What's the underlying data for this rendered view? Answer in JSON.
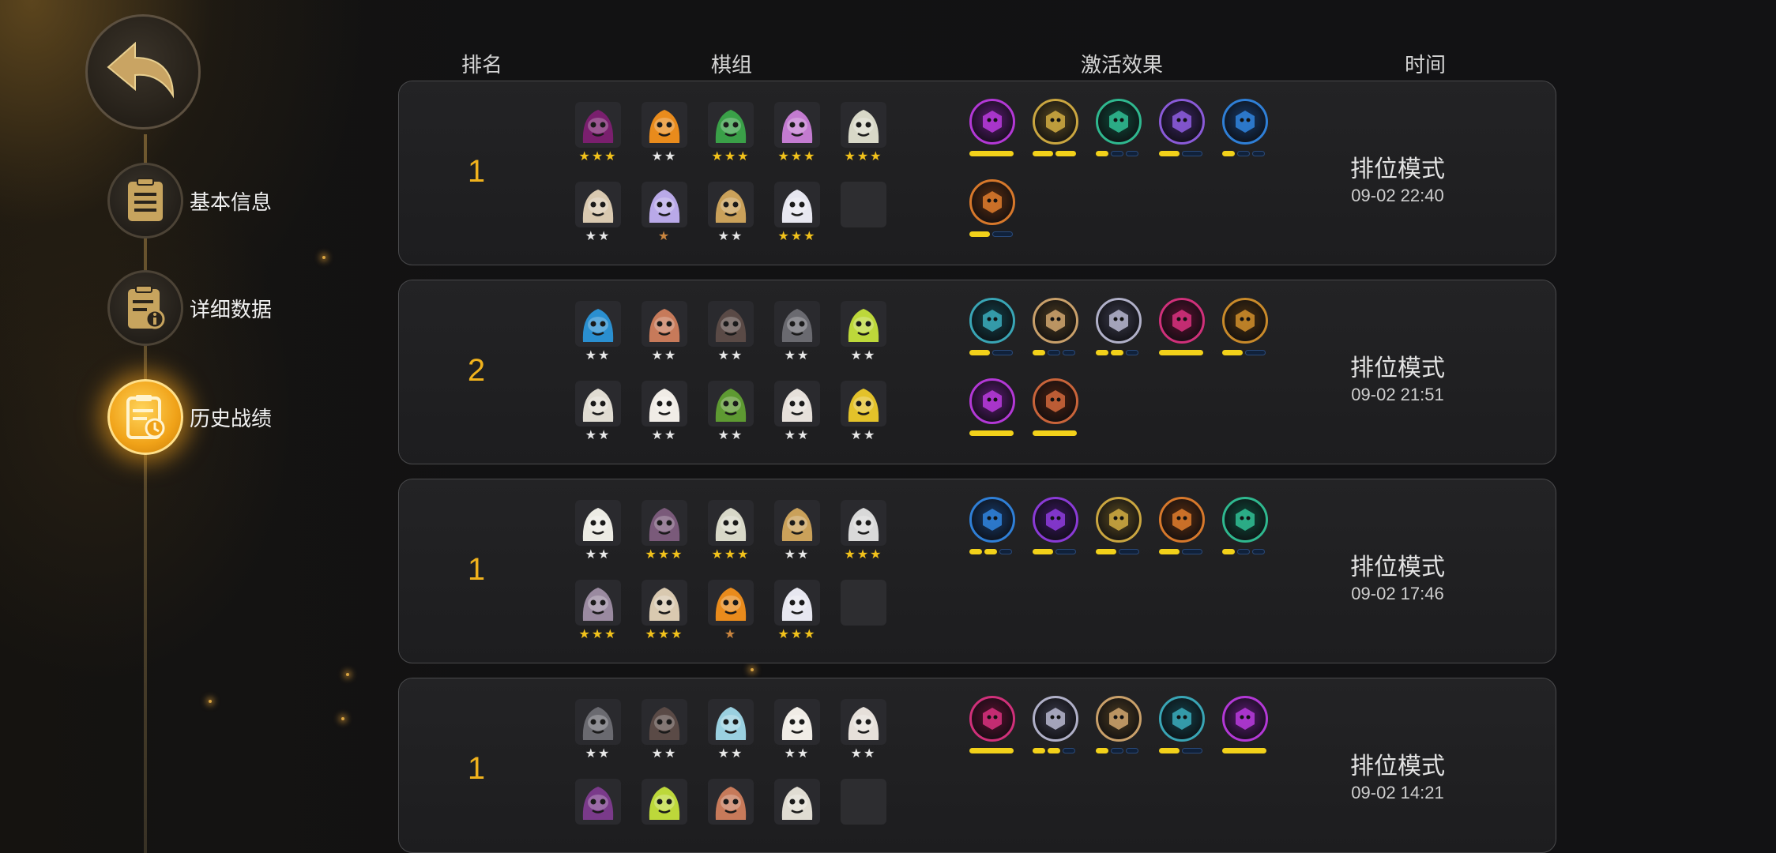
{
  "header": {
    "rank": "排名",
    "lineup": "棋组",
    "synergy": "激活效果",
    "time": "时间"
  },
  "menu": [
    {
      "label": "基本信息",
      "icon": "document-list-icon",
      "active": false
    },
    {
      "label": "详细数据",
      "icon": "document-info-icon",
      "active": false
    },
    {
      "label": "历史战绩",
      "icon": "history-clock-icon",
      "active": true
    }
  ],
  "colors": {
    "accent": "#f0b21d",
    "bar_active": "#f2d11a",
    "bar_inactive": "#10213a"
  },
  "matches": [
    {
      "rank": "1",
      "mode": "排位模式",
      "time": "09-02 22:40",
      "pieces": [
        {
          "name": "red-demon-piece",
          "color": "#7a1f6e",
          "stars": "★★★",
          "tier": "gold"
        },
        {
          "name": "orange-slug-piece",
          "color": "#e98b1c",
          "stars": "★★",
          "tier": "silver"
        },
        {
          "name": "green-goggle-piece",
          "color": "#3aa048",
          "stars": "★★★",
          "tier": "gold"
        },
        {
          "name": "pink-hair-piece",
          "color": "#c37bd0",
          "stars": "★★★",
          "tier": "gold"
        },
        {
          "name": "white-hat-piece",
          "color": "#d8d8c8",
          "stars": "★★★",
          "tier": "gold"
        },
        {
          "name": "cowboy-piece",
          "color": "#d9c9b0",
          "stars": "★★",
          "tier": "silver"
        },
        {
          "name": "purple-cat-piece",
          "color": "#b9a9e8",
          "stars": "★",
          "tier": "bronze"
        },
        {
          "name": "hooded-monk-piece",
          "color": "#caa15a",
          "stars": "★★",
          "tier": "silver"
        },
        {
          "name": "ice-chef-piece",
          "color": "#e7e7f0",
          "stars": "★★★",
          "tier": "gold"
        },
        {
          "name": "empty-slot",
          "color": "",
          "stars": "",
          "tier": "silver"
        }
      ],
      "synergies": [
        {
          "name": "demon-synergy-icon",
          "color": "#b338d6",
          "ring": "#5c1a74",
          "bars": [
            1
          ],
          "width": 56
        },
        {
          "name": "claw-synergy-icon",
          "color": "#caa640",
          "ring": "#5a4a20",
          "bars": [
            1,
            1
          ],
          "width": 26
        },
        {
          "name": "beast-synergy-icon",
          "color": "#2fb88f",
          "ring": "#0f4a3a",
          "bars": [
            1,
            0,
            0
          ],
          "width": 16
        },
        {
          "name": "fish-synergy-icon",
          "color": "#8a5ad8",
          "ring": "#3a2460",
          "bars": [
            1,
            0
          ],
          "width": 26
        },
        {
          "name": "feather-synergy-icon",
          "color": "#2f7fd6",
          "ring": "#163a6a",
          "bars": [
            1,
            0,
            0
          ],
          "width": 16
        },
        {
          "name": "leaf-synergy-icon",
          "color": "#d7782b",
          "ring": "#5a2d10",
          "bars": [
            1,
            0
          ],
          "width": 26
        }
      ]
    },
    {
      "rank": "2",
      "mode": "排位模式",
      "time": "09-02 21:51",
      "pieces": [
        {
          "name": "blue-robot-piece",
          "color": "#2a8fd0",
          "stars": "★★",
          "tier": "silver"
        },
        {
          "name": "screaming-ogre-piece",
          "color": "#c77a5a",
          "stars": "★★",
          "tier": "silver"
        },
        {
          "name": "red-hat-bandit-piece",
          "color": "#5a4a46",
          "stars": "★★",
          "tier": "silver"
        },
        {
          "name": "goblin-piece",
          "color": "#6a6a70",
          "stars": "★★",
          "tier": "silver"
        },
        {
          "name": "green-frog-piece",
          "color": "#bdd83a",
          "stars": "★★",
          "tier": "silver"
        },
        {
          "name": "skull-warrior-piece",
          "color": "#e0dcd2",
          "stars": "★★",
          "tier": "silver"
        },
        {
          "name": "sheep-piece",
          "color": "#f0ece6",
          "stars": "★★",
          "tier": "silver"
        },
        {
          "name": "green-orc-piece",
          "color": "#5e9a32",
          "stars": "★★",
          "tier": "silver"
        },
        {
          "name": "bald-monk-piece",
          "color": "#e6e0da",
          "stars": "★★",
          "tier": "silver"
        },
        {
          "name": "yellow-mech-piece",
          "color": "#e3c22a",
          "stars": "★★",
          "tier": "silver"
        }
      ],
      "synergies": [
        {
          "name": "mystery-synergy-icon",
          "color": "#39a5b5",
          "ring": "#12414a",
          "bars": [
            1,
            0
          ],
          "width": 26
        },
        {
          "name": "axe-synergy-icon",
          "color": "#c9a06a",
          "ring": "#4a3a20",
          "bars": [
            1,
            0,
            0
          ],
          "width": 16
        },
        {
          "name": "human-synergy-icon",
          "color": "#b0b0c8",
          "ring": "#3a3a4a",
          "bars": [
            1,
            1,
            0
          ],
          "width": 16
        },
        {
          "name": "dragon-synergy-icon",
          "color": "#d0307a",
          "ring": "#5a1030",
          "bars": [
            1
          ],
          "width": 56
        },
        {
          "name": "gear-synergy-icon",
          "color": "#c98a2a",
          "ring": "#4a3010",
          "bars": [
            1,
            0
          ],
          "width": 26
        },
        {
          "name": "demon-synergy-icon",
          "color": "#b338d6",
          "ring": "#5c1a74",
          "bars": [
            1
          ],
          "width": 56
        },
        {
          "name": "horned-synergy-icon",
          "color": "#c9643a",
          "ring": "#4a2010",
          "bars": [
            1
          ],
          "width": 56
        }
      ]
    },
    {
      "rank": "1",
      "mode": "排位模式",
      "time": "09-02 17:46",
      "pieces": [
        {
          "name": "white-mask-piece",
          "color": "#ecebe4",
          "stars": "★★",
          "tier": "silver"
        },
        {
          "name": "dark-witch-piece",
          "color": "#7a5a7a",
          "stars": "★★★",
          "tier": "gold"
        },
        {
          "name": "white-hat-piece",
          "color": "#d8d8c8",
          "stars": "★★★",
          "tier": "gold"
        },
        {
          "name": "hooded-monk-piece",
          "color": "#caa15a",
          "stars": "★★",
          "tier": "silver"
        },
        {
          "name": "white-hair-piece",
          "color": "#d9d9d9",
          "stars": "★★★",
          "tier": "gold"
        },
        {
          "name": "helmet-knight-piece",
          "color": "#9a8aa0",
          "stars": "★★★",
          "tier": "gold"
        },
        {
          "name": "cowboy-piece",
          "color": "#d9c9b0",
          "stars": "★★★",
          "tier": "gold"
        },
        {
          "name": "orange-slug-piece",
          "color": "#e98b1c",
          "stars": "★",
          "tier": "bronze"
        },
        {
          "name": "ice-chef-piece",
          "color": "#e7e7f0",
          "stars": "★★★",
          "tier": "gold"
        },
        {
          "name": "empty-slot",
          "color": "",
          "stars": "",
          "tier": "silver"
        }
      ],
      "synergies": [
        {
          "name": "feather-synergy-icon",
          "color": "#2f7fd6",
          "ring": "#163a6a",
          "bars": [
            1,
            1,
            0
          ],
          "width": 16
        },
        {
          "name": "hand-synergy-icon",
          "color": "#8a3ad6",
          "ring": "#3a1660",
          "bars": [
            1,
            0
          ],
          "width": 26
        },
        {
          "name": "claw-synergy-icon",
          "color": "#caa640",
          "ring": "#5a4a20",
          "bars": [
            1,
            0
          ],
          "width": 26
        },
        {
          "name": "leaf-synergy-icon",
          "color": "#d7782b",
          "ring": "#5a2d10",
          "bars": [
            1,
            0
          ],
          "width": 26
        },
        {
          "name": "beast-synergy-icon",
          "color": "#2fb88f",
          "ring": "#0f4a3a",
          "bars": [
            1,
            0,
            0
          ],
          "width": 16
        }
      ]
    },
    {
      "rank": "1",
      "mode": "排位模式",
      "time": "09-02 14:21",
      "pieces": [
        {
          "name": "goblin-piece",
          "color": "#6a6a70",
          "stars": "★★",
          "tier": "silver"
        },
        {
          "name": "red-hat-bandit-piece",
          "color": "#5a4a46",
          "stars": "★★",
          "tier": "silver"
        },
        {
          "name": "blue-bear-piece",
          "color": "#9ad0e0",
          "stars": "★★",
          "tier": "silver"
        },
        {
          "name": "sheep-piece",
          "color": "#f0ece6",
          "stars": "★★",
          "tier": "silver"
        },
        {
          "name": "bald-monk-piece",
          "color": "#e6e0da",
          "stars": "★★",
          "tier": "silver"
        },
        {
          "name": "pink-bug-piece",
          "color": "#7a3a8a",
          "stars": "",
          "tier": "silver"
        },
        {
          "name": "green-frog-piece",
          "color": "#bdd83a",
          "stars": "",
          "tier": "silver"
        },
        {
          "name": "screaming-ogre-piece",
          "color": "#c77a5a",
          "stars": "",
          "tier": "silver"
        },
        {
          "name": "skull-warrior-piece",
          "color": "#e0dcd2",
          "stars": "",
          "tier": "silver"
        },
        {
          "name": "empty-slot",
          "color": "",
          "stars": "",
          "tier": "silver"
        }
      ],
      "synergies": [
        {
          "name": "dragon-synergy-icon",
          "color": "#d0307a",
          "ring": "#5a1030",
          "bars": [
            1
          ],
          "width": 56
        },
        {
          "name": "human-synergy-icon",
          "color": "#b0b0c8",
          "ring": "#3a3a4a",
          "bars": [
            1,
            1,
            0
          ],
          "width": 16
        },
        {
          "name": "axe-synergy-icon",
          "color": "#c9a06a",
          "ring": "#4a3a20",
          "bars": [
            1,
            0,
            0
          ],
          "width": 16
        },
        {
          "name": "mystery-synergy-icon",
          "color": "#39a5b5",
          "ring": "#12414a",
          "bars": [
            1,
            0
          ],
          "width": 26
        },
        {
          "name": "demon-synergy-icon",
          "color": "#b338d6",
          "ring": "#5c1a74",
          "bars": [
            1
          ],
          "width": 56
        }
      ]
    }
  ]
}
